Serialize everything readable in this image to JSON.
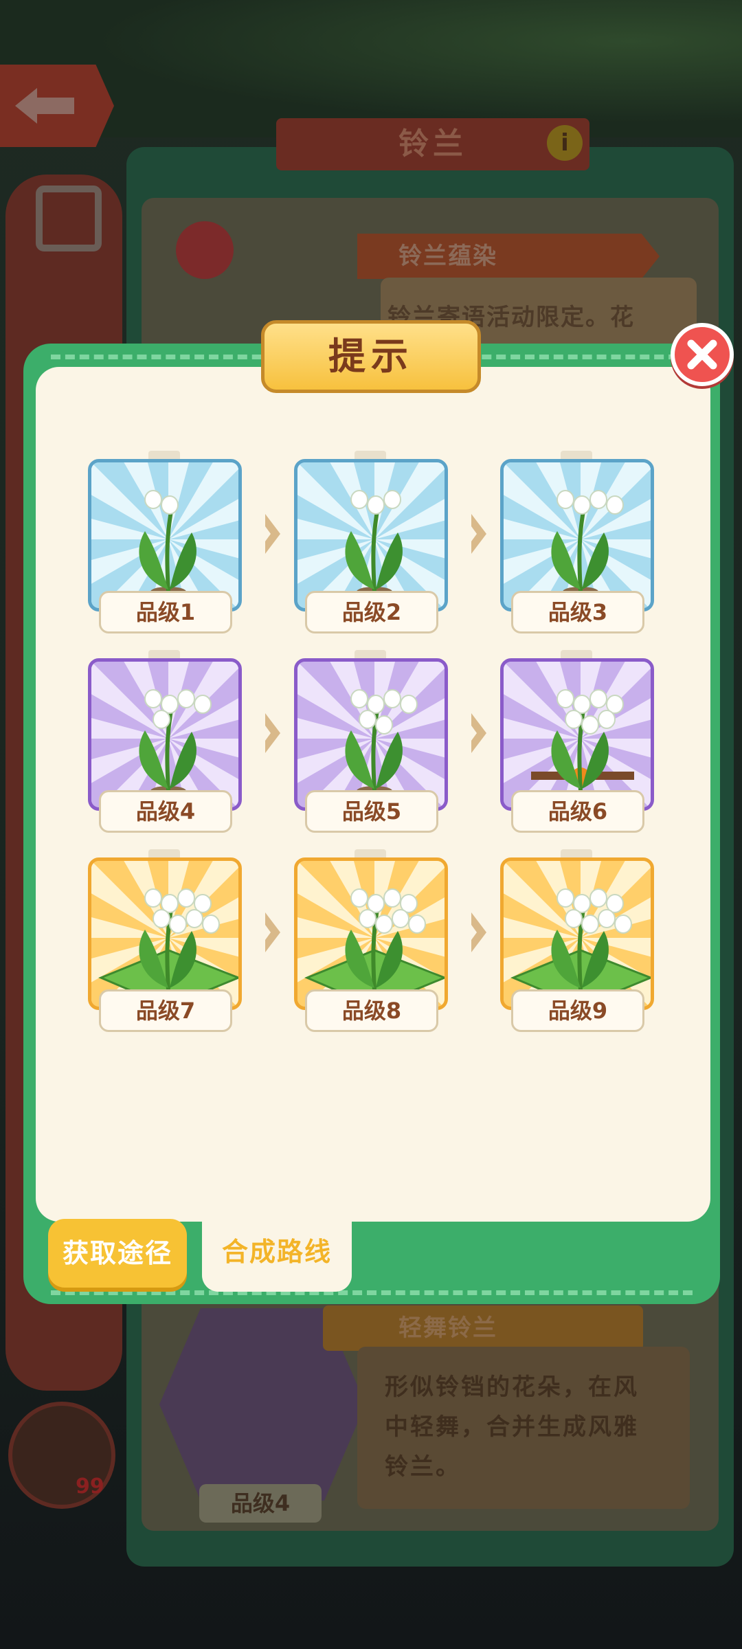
{
  "background": {
    "info_title": "铃兰",
    "info_icon": "i",
    "card_banner": "铃兰蕴染",
    "card_desc": "铃兰寄语活动限定。花",
    "bottom_banner": "轻舞铃兰",
    "bottom_desc_lines": [
      "形似铃铛的花朵，在风",
      "中轻舞，合并生成风雅",
      "铃兰。"
    ],
    "bottom_grade": "品级4",
    "hand_count": "99"
  },
  "dialog": {
    "title": "提示",
    "close_icon": "close-x-icon",
    "grades": [
      {
        "label": "品级1",
        "tier": "blue"
      },
      {
        "label": "品级2",
        "tier": "blue"
      },
      {
        "label": "品级3",
        "tier": "blue"
      },
      {
        "label": "品级4",
        "tier": "purple"
      },
      {
        "label": "品级5",
        "tier": "purple"
      },
      {
        "label": "品级6",
        "tier": "purple"
      },
      {
        "label": "品级7",
        "tier": "gold"
      },
      {
        "label": "品级8",
        "tier": "gold"
      },
      {
        "label": "品级9",
        "tier": "gold"
      }
    ],
    "tabs": {
      "get": "获取途径",
      "route": "合成路线"
    }
  },
  "colors": {
    "dialog_green": "#3cae6a",
    "cream": "#fbf5e6",
    "label_brown": "#8a4a26",
    "tab_yellow": "#f7c234",
    "close_red": "#ef5350"
  }
}
